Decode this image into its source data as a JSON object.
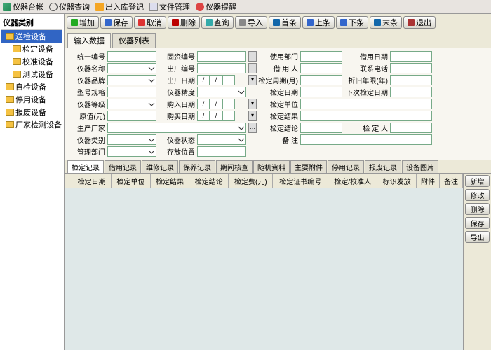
{
  "topTabs": [
    "仪器台帐",
    "仪器查询",
    "出入库登记",
    "文件管理",
    "仪器提醒"
  ],
  "sidebar": {
    "title": "仪器类别",
    "items": [
      {
        "label": "送检设备",
        "sel": true,
        "depth": 0
      },
      {
        "label": "检定设备",
        "depth": 1
      },
      {
        "label": "校准设备",
        "depth": 1
      },
      {
        "label": "测试设备",
        "depth": 1
      },
      {
        "label": "自检设备",
        "depth": 0
      },
      {
        "label": "停用设备",
        "depth": 0
      },
      {
        "label": "报废设备",
        "depth": 0
      },
      {
        "label": "厂家检测设备",
        "depth": 0
      }
    ]
  },
  "toolbar": [
    "增加",
    "保存",
    "取消",
    "删除",
    "查询",
    "导入",
    "首条",
    "上条",
    "下条",
    "末条",
    "退出"
  ],
  "toolbarIcons": [
    "add",
    "save",
    "cancel",
    "del",
    "query",
    "imp",
    "first",
    "up",
    "down",
    "last",
    "exit"
  ],
  "formTabs": [
    "输入数据",
    "仪器列表"
  ],
  "form": {
    "r1": {
      "a": "统一编号",
      "b": "固资编号",
      "c": "使用部门",
      "d": "借用日期"
    },
    "r2": {
      "a": "仪器名称",
      "b": "出厂编号",
      "c": "借 用 人",
      "d": "联系电话"
    },
    "r3": {
      "a": "仪器品牌",
      "b": "出厂日期",
      "c": "检定周期(月)",
      "d": "折旧年限(年)"
    },
    "r4": {
      "a": "型号规格",
      "b": "仪器精度",
      "c": "检定日期",
      "d": "下次检定日期"
    },
    "r5": {
      "a": "仪器等级",
      "b": "购入日期",
      "c": "检定单位"
    },
    "r6": {
      "a": "原值(元)",
      "b": "购买日期",
      "c": "检定结果"
    },
    "r7": {
      "a": "生产厂家",
      "c": "检定结论",
      "d": "检 定 人"
    },
    "r8": {
      "a": "仪器类别",
      "b": "仪器状态",
      "c": "备   注"
    },
    "r9": {
      "a": "管理部门",
      "b": "存放位置"
    }
  },
  "recordTabs": [
    "检定记录",
    "借用记录",
    "维修记录",
    "保养记录",
    "期间核查",
    "随机资料",
    "主要附件",
    "停用记录",
    "报废记录",
    "设备图片"
  ],
  "gridCols": [
    "",
    "检定日期",
    "检定单位",
    "检定结果",
    "检定结论",
    "检定费(元)",
    "检定证书编号",
    "检定/校准人",
    "标识发放",
    "附件",
    "备注"
  ],
  "sideActions": [
    "新增",
    "修改",
    "删除",
    "保存",
    "导出"
  ]
}
